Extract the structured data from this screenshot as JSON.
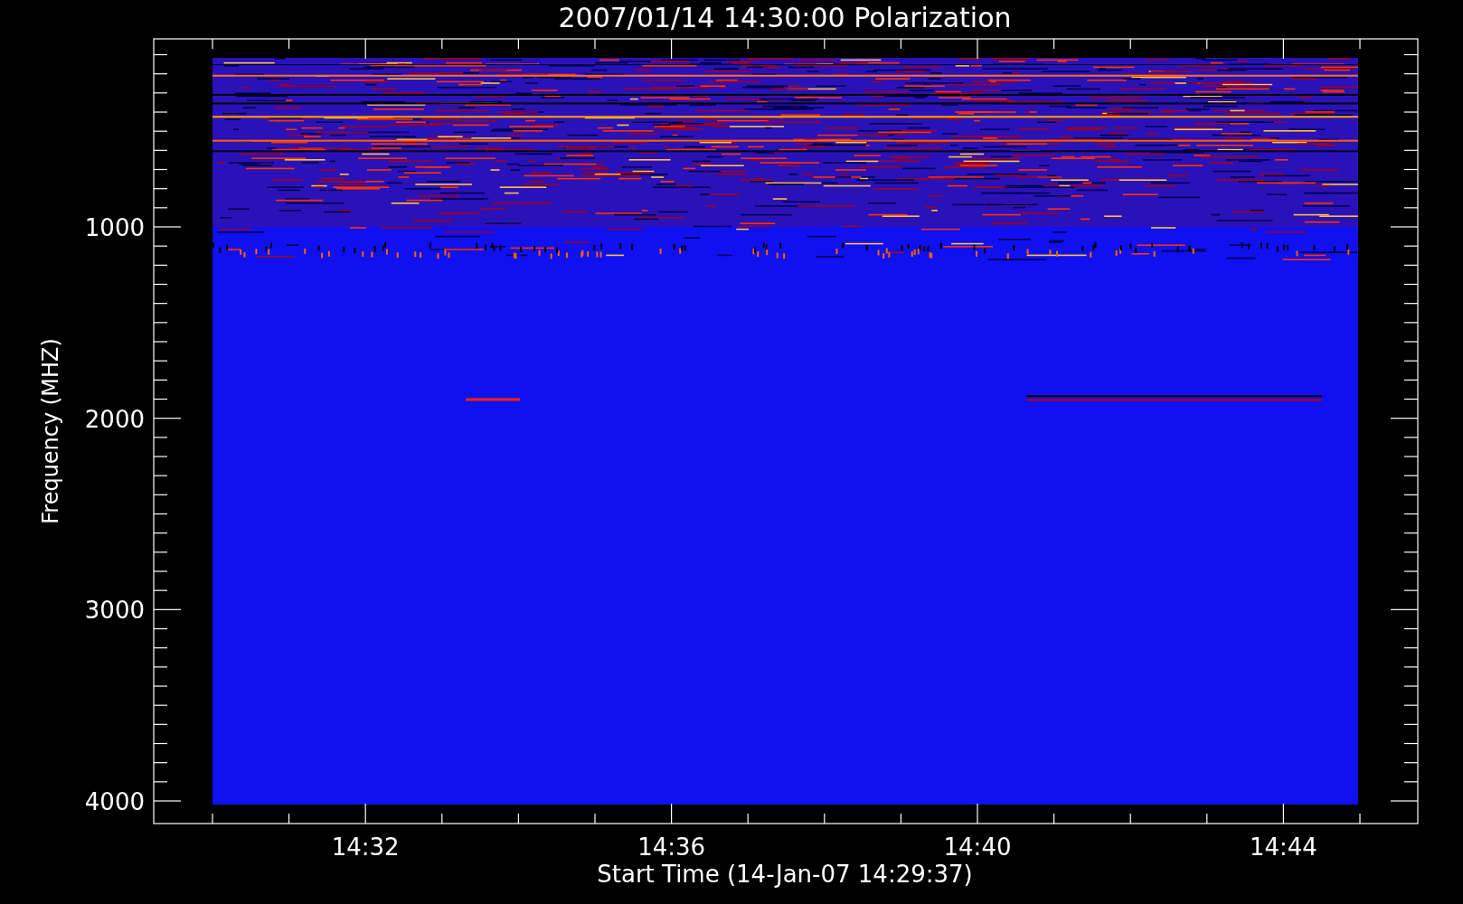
{
  "title": "2007/01/14 14:30:00 Polarization",
  "y_axis": {
    "label": "Frequency (MHZ)",
    "ticks": [
      "1000",
      "2000",
      "3000",
      "4000"
    ]
  },
  "x_axis": {
    "label": "Start Time (14-Jan-07 14:29:37)",
    "ticks": [
      "14:32",
      "14:36",
      "14:40",
      "14:44"
    ]
  }
}
